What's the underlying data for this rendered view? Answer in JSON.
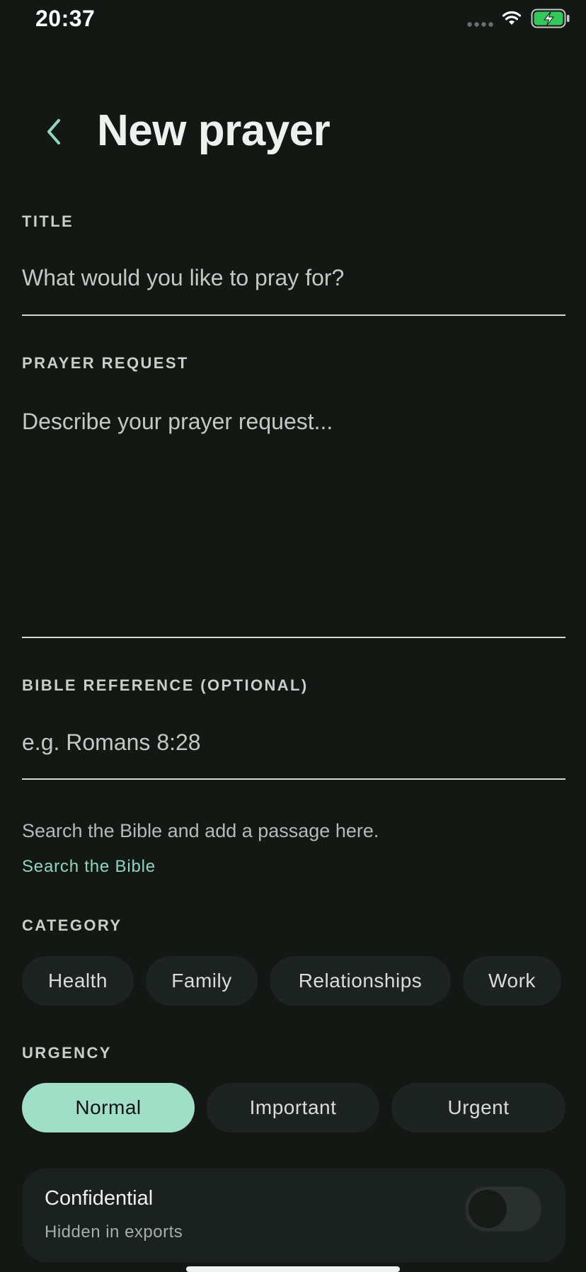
{
  "status_bar": {
    "time": "20:37",
    "icons": [
      "cellular-signal-icon",
      "wifi-icon",
      "battery-charging-icon"
    ]
  },
  "header": {
    "back_icon": "chevron-left-icon",
    "title": "New prayer"
  },
  "form": {
    "title_field": {
      "label": "TITLE",
      "placeholder": "What would you like to pray for?",
      "value": ""
    },
    "request_field": {
      "label": "PRAYER REQUEST",
      "placeholder": "Describe your prayer request...",
      "value": ""
    },
    "reference_field": {
      "label": "BIBLE REFERENCE (OPTIONAL)",
      "placeholder": "e.g. Romans 8:28",
      "value": ""
    },
    "helper_text": "Search the Bible and add a passage here.",
    "search_link": "Search the Bible",
    "category": {
      "label": "CATEGORY",
      "options": [
        "Health",
        "Family",
        "Relationships",
        "Work"
      ]
    },
    "urgency": {
      "label": "URGENCY",
      "options": [
        "Normal",
        "Important",
        "Urgent"
      ],
      "selected": "Normal"
    },
    "confidential": {
      "title": "Confidential",
      "subtitle": "Hidden in exports",
      "enabled": false
    }
  },
  "colors": {
    "background": "#131815",
    "accent": "#a1dec8",
    "link": "#8fd6bd",
    "chip": "#1d2320",
    "battery_fill": "#34c759"
  }
}
